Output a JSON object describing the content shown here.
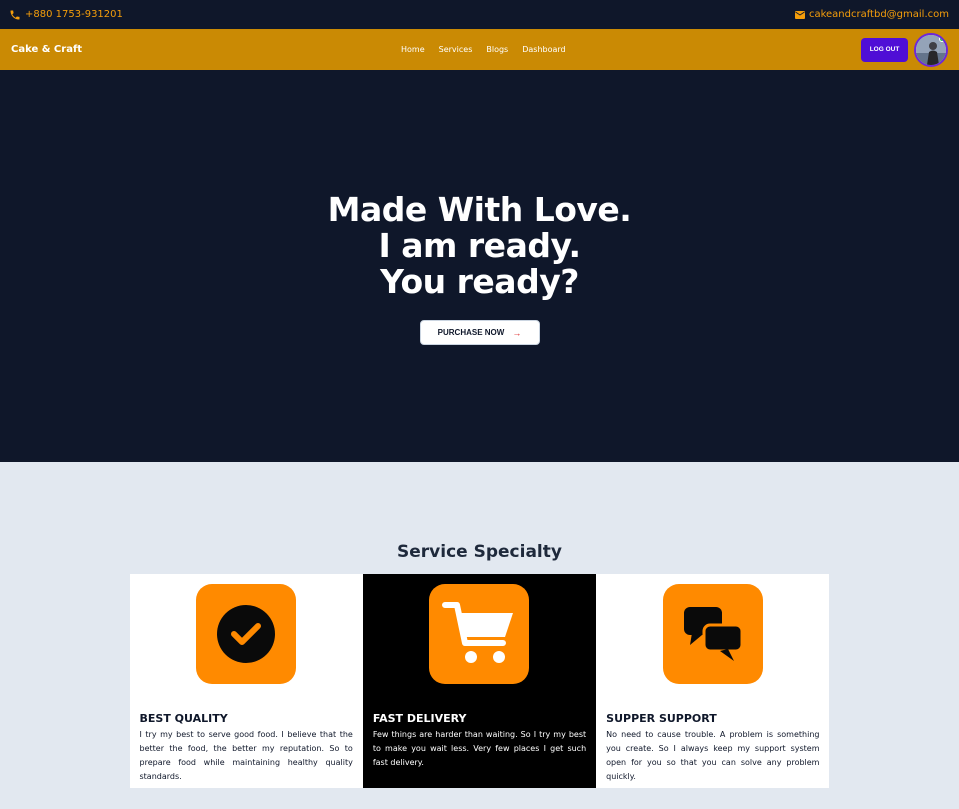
{
  "topbar": {
    "phone": "+880 1753-931201",
    "email": "cakeandcraftbd@gmail.com",
    "phone_icon": "phone-icon",
    "email_icon": "envelope-icon"
  },
  "navbar": {
    "brand": "Cake & Craft",
    "links": [
      "Home",
      "Services",
      "Blogs",
      "Dashboard"
    ],
    "logout_label": "LOG OUT"
  },
  "hero": {
    "line1": "Made With Love.",
    "line2": "I am ready.",
    "line3": "You ready?",
    "cta_label": "PURCHASE NOW",
    "cta_arrow": "→"
  },
  "services": {
    "heading": "Service Specialty",
    "cards": [
      {
        "icon": "check-circle-icon",
        "title": "BEST QUALITY",
        "text": "I try my best to serve good food. I believe that the better the food, the better my reputation. So to prepare food while maintaining healthy quality standards."
      },
      {
        "icon": "cart-icon",
        "title": "FAST DELIVERY",
        "text": "Few things are harder than waiting. So I try my best to make you wait less. Very few places I get such fast delivery."
      },
      {
        "icon": "chat-bubbles-icon",
        "title": "SUPPER SUPPORT",
        "text": "No need to cause trouble. A problem is something you create. So I always keep my support system open for you so that you can solve any problem quickly."
      }
    ]
  },
  "colors": {
    "dark": "#0f172a",
    "gold": "#ca8a04",
    "accent_orange": "#ff8a00",
    "logout": "#4f0ed6"
  }
}
